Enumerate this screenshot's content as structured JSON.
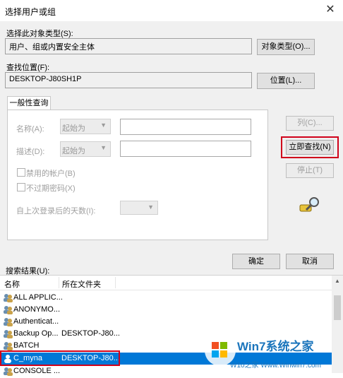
{
  "window": {
    "title": "选择用户或组",
    "close_glyph": "✕"
  },
  "object_type": {
    "label": "选择此对象类型(S):",
    "value": "用户、组或内置安全主体",
    "button": "对象类型(O)..."
  },
  "location": {
    "label": "查找位置(F):",
    "value": "DESKTOP-J80SH1P",
    "button": "位置(L)..."
  },
  "tab": {
    "label": "一般性查询"
  },
  "query": {
    "name_label": "名称(A):",
    "name_op": "起始为",
    "desc_label": "描述(D):",
    "desc_op": "起始为",
    "disabled_accounts": "禁用的帐户(B)",
    "no_expire_password": "不过期密码(X)",
    "days_since_login": "自上次登录后的天数(I):"
  },
  "side_buttons": {
    "columns": "列(C)...",
    "find_now": "立即查找(N)",
    "stop": "停止(T)"
  },
  "search_icon": "search-magnifier-icon",
  "actions": {
    "ok": "确定",
    "cancel": "取消"
  },
  "results": {
    "label": "搜索结果(U):",
    "columns": [
      "名称",
      "所在文件夹"
    ],
    "rows": [
      {
        "name": "ALL APPLIC...",
        "folder": ""
      },
      {
        "name": "ANONYMO...",
        "folder": ""
      },
      {
        "name": "Authenticat...",
        "folder": ""
      },
      {
        "name": "Backup Op...",
        "folder": "DESKTOP-J80..."
      },
      {
        "name": "BATCH",
        "folder": ""
      },
      {
        "name": "C_myna",
        "folder": "DESKTOP-J80..."
      },
      {
        "name": "CONSOLE ...",
        "folder": ""
      }
    ],
    "selected_index": 5
  },
  "watermark": {
    "line1": "Win7系统之家",
    "line2": "W10之家 Www.Winwin7.com"
  },
  "colors": {
    "highlight_red": "#d0021b",
    "selection_blue": "#0078d7"
  }
}
